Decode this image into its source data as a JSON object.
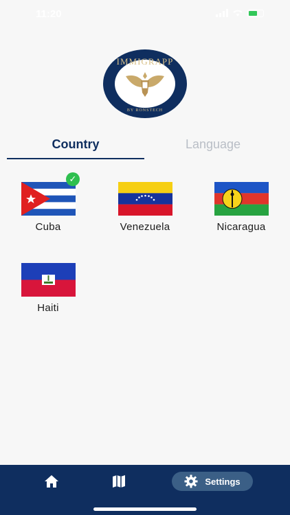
{
  "status_bar": {
    "time": "11:20"
  },
  "logo": {
    "top_text": "IMMIGRAPP",
    "bottom_text": "BY RONSTECH"
  },
  "tabs": [
    {
      "label": "Country",
      "active": true
    },
    {
      "label": "Language",
      "active": false
    }
  ],
  "countries": [
    {
      "name": "Cuba",
      "selected": true
    },
    {
      "name": "Venezuela",
      "selected": false
    },
    {
      "name": "Nicaragua",
      "selected": false
    },
    {
      "name": "Haiti",
      "selected": false
    }
  ],
  "bottom_nav": {
    "home_icon": "home-icon",
    "map_icon": "map-icon",
    "settings_icon": "gear-icon",
    "settings_label": "Settings"
  },
  "colors": {
    "brand_navy": "#0f2e5f",
    "accent_gold": "#d8c088",
    "check_green": "#2fbf4f",
    "settings_pill": "#3b5f86"
  }
}
